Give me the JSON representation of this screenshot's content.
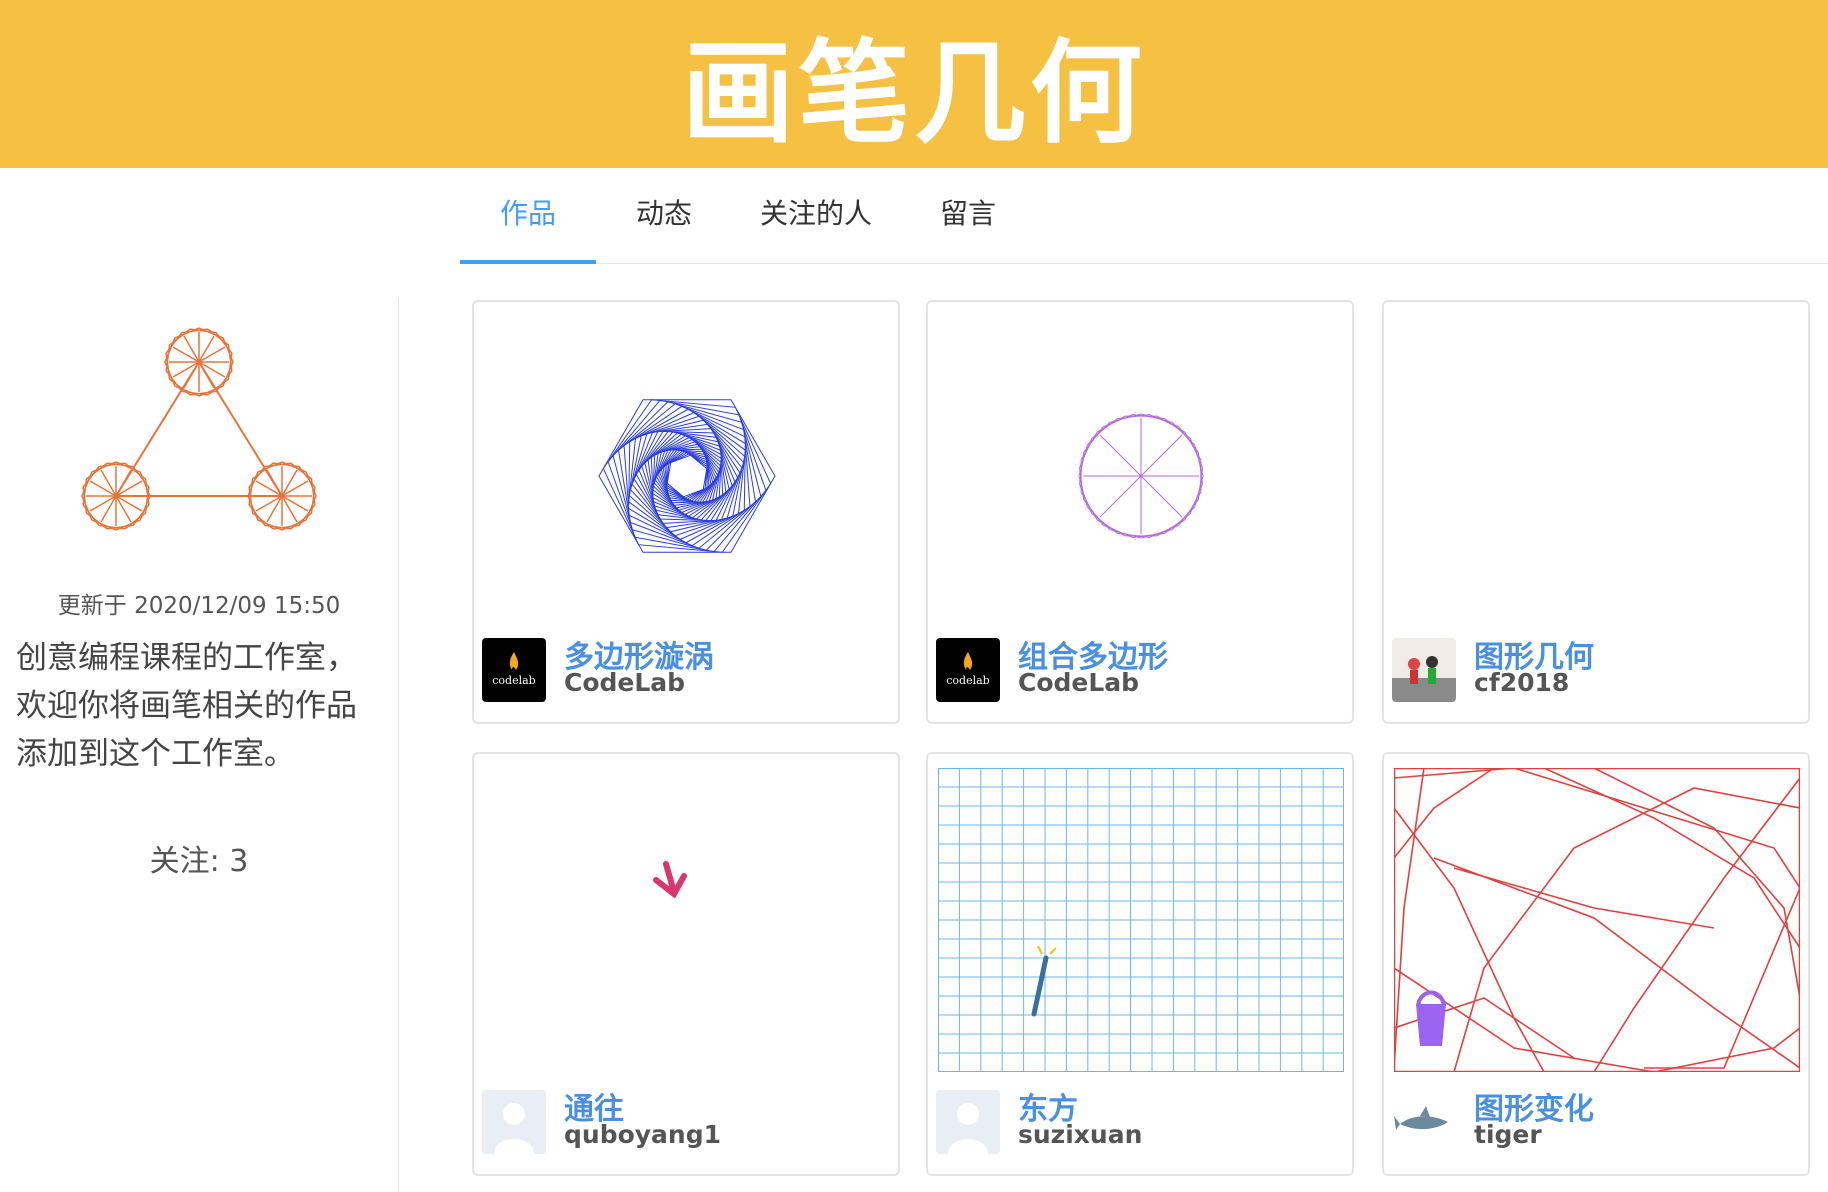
{
  "header": {
    "title": "画笔几何"
  },
  "tabs": [
    {
      "label": "作品",
      "active": true
    },
    {
      "label": "动态",
      "active": false
    },
    {
      "label": "关注的人",
      "active": false
    },
    {
      "label": "留言",
      "active": false
    }
  ],
  "sidebar": {
    "updated": "更新于 2020/12/09 15:50",
    "description": "创意编程课程的工作室，欢迎你将画笔相关的作品添加到这个工作室。",
    "follow": "关注: 3"
  },
  "projects": [
    {
      "title": "多边形漩涡",
      "author": "CodeLab",
      "thumb": "blue-hexagon-spiral",
      "avatar": "codelab-logo-icon"
    },
    {
      "title": "组合多边形",
      "author": "CodeLab",
      "thumb": "purple-polygon-rosette",
      "avatar": "codelab-logo-icon"
    },
    {
      "title": "图形几何",
      "author": "cf2018",
      "thumb": "blank",
      "avatar": "photo-avatar"
    },
    {
      "title": "通往",
      "author": "quboyang1",
      "thumb": "pink-arrow",
      "avatar": "default-avatar-icon"
    },
    {
      "title": "东方",
      "author": "suzixuan",
      "thumb": "grid-with-wand",
      "avatar": "default-avatar-icon"
    },
    {
      "title": "图形变化",
      "author": "tiger",
      "thumb": "red-lines-with-bucket",
      "avatar": "shark-avatar"
    }
  ],
  "colors": {
    "header": "#f6c142",
    "accent": "#409eff",
    "title": "#4a90e2",
    "logo": "#e8743b"
  },
  "avatar_text": {
    "codelab": "codelab"
  }
}
